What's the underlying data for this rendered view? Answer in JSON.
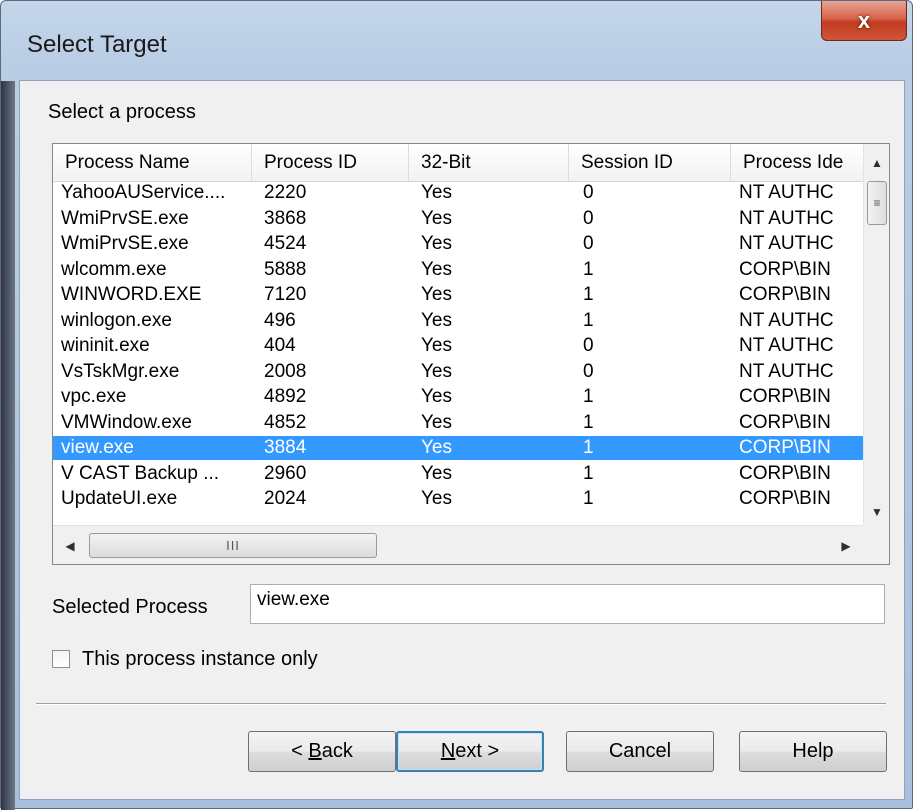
{
  "window": {
    "title": "Select Target",
    "close_label": "x"
  },
  "section_label": "Select a process",
  "process_list": {
    "columns": [
      "Process Name",
      "Process ID",
      "32-Bit",
      "Session ID",
      "Process Ide"
    ],
    "rows": [
      {
        "name": "YahooAUService....",
        "pid": "2220",
        "bit32": "Yes",
        "session": "0",
        "identity": "NT AUTHC"
      },
      {
        "name": "WmiPrvSE.exe",
        "pid": "3868",
        "bit32": "Yes",
        "session": "0",
        "identity": "NT AUTHC"
      },
      {
        "name": "WmiPrvSE.exe",
        "pid": "4524",
        "bit32": "Yes",
        "session": "0",
        "identity": "NT AUTHC"
      },
      {
        "name": "wlcomm.exe",
        "pid": "5888",
        "bit32": "Yes",
        "session": "1",
        "identity": "CORP\\BIN"
      },
      {
        "name": "WINWORD.EXE",
        "pid": "7120",
        "bit32": "Yes",
        "session": "1",
        "identity": "CORP\\BIN"
      },
      {
        "name": "winlogon.exe",
        "pid": "496",
        "bit32": "Yes",
        "session": "1",
        "identity": "NT AUTHC"
      },
      {
        "name": "wininit.exe",
        "pid": "404",
        "bit32": "Yes",
        "session": "0",
        "identity": "NT AUTHC"
      },
      {
        "name": "VsTskMgr.exe",
        "pid": "2008",
        "bit32": "Yes",
        "session": "0",
        "identity": "NT AUTHC"
      },
      {
        "name": "vpc.exe",
        "pid": "4892",
        "bit32": "Yes",
        "session": "1",
        "identity": "CORP\\BIN"
      },
      {
        "name": "VMWindow.exe",
        "pid": "4852",
        "bit32": "Yes",
        "session": "1",
        "identity": "CORP\\BIN"
      },
      {
        "name": "view.exe",
        "pid": "3884",
        "bit32": "Yes",
        "session": "1",
        "identity": "CORP\\BIN"
      },
      {
        "name": "V CAST Backup ...",
        "pid": "2960",
        "bit32": "Yes",
        "session": "1",
        "identity": "CORP\\BIN"
      },
      {
        "name": "UpdateUI.exe",
        "pid": "2024",
        "bit32": "Yes",
        "session": "1",
        "identity": "CORP\\BIN"
      }
    ],
    "selected_index": 10,
    "selection_color": "#3399ff"
  },
  "selected_process": {
    "label": "Selected Process",
    "value": "view.exe"
  },
  "instance_checkbox": {
    "label": "This process instance only",
    "checked": false
  },
  "buttons": {
    "back": {
      "prefix": "< ",
      "accel": "B",
      "rest": "ack"
    },
    "next": {
      "prefix": "",
      "accel": "N",
      "rest": "ext >"
    },
    "cancel": "Cancel",
    "help": "Help"
  }
}
